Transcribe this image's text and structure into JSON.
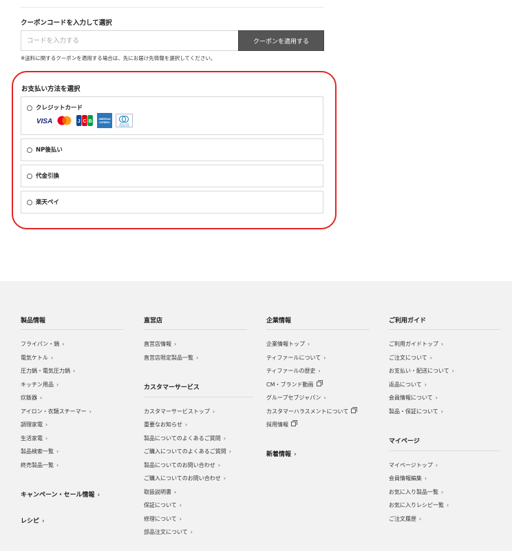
{
  "coupon": {
    "title": "クーポンコードを入力して選択",
    "placeholder": "コードを入力する",
    "apply_label": "クーポンを適用する",
    "note": "※送料に関するクーポンを適用する場合は、先にお届け先情報を選択してください。"
  },
  "payment": {
    "title": "お支払い方法を選択",
    "highlight_color": "#e32222",
    "options": [
      {
        "label": "クレジットカード",
        "cards": [
          "VISA",
          "Mastercard",
          "JCB",
          "AMERICAN EXPRESS",
          "Diners Club INTERNATIONAL"
        ]
      },
      {
        "label": "NP後払い"
      },
      {
        "label": "代金引換"
      },
      {
        "label": "楽天ペイ"
      }
    ]
  },
  "footer": {
    "col1": {
      "heading": "製品情報",
      "links": [
        "フライパン・鍋",
        "電気ケトル",
        "圧力鍋・電気圧力鍋",
        "キッチン用品",
        "炊飯器",
        "アイロン・衣類スチーマー",
        "調理家電",
        "生活家電",
        "製品検索一覧",
        "終売製品一覧"
      ],
      "extra1": "キャンペーン・セール情報",
      "extra2": "レシピ"
    },
    "col2": {
      "heading": "直営店",
      "links": [
        "直営店情報",
        "直営店限定製品一覧"
      ],
      "heading2": "カスタマーサービス",
      "links2": [
        "カスタマーサービストップ",
        "重要なお知らせ",
        "製品についてのよくあるご質問",
        "ご購入についてのよくあるご質問",
        "製品についてのお問い合わせ",
        "ご購入についてのお問い合わせ",
        "取扱説明書",
        "保証について",
        "修理について",
        "部品注文について"
      ]
    },
    "col3": {
      "heading": "企業情報",
      "links": [
        "企業情報トップ",
        "ティファールについて",
        "ティファールの歴史",
        "CM・ブランド動画",
        "グループセブジャパン",
        "カスタマーハラスメントについて",
        "採用情報"
      ],
      "extra": "新着情報"
    },
    "col4": {
      "heading": "ご利用ガイド",
      "links": [
        "ご利用ガイドトップ",
        "ご注文について",
        "お支払い・配送について",
        "返品について",
        "会員情報について",
        "製品・保証について"
      ],
      "heading2": "マイページ",
      "links2": [
        "マイページトップ",
        "会員情報編集",
        "お気に入り製品一覧",
        "お気に入りレシピ一覧",
        "ご注文履歴"
      ]
    }
  }
}
